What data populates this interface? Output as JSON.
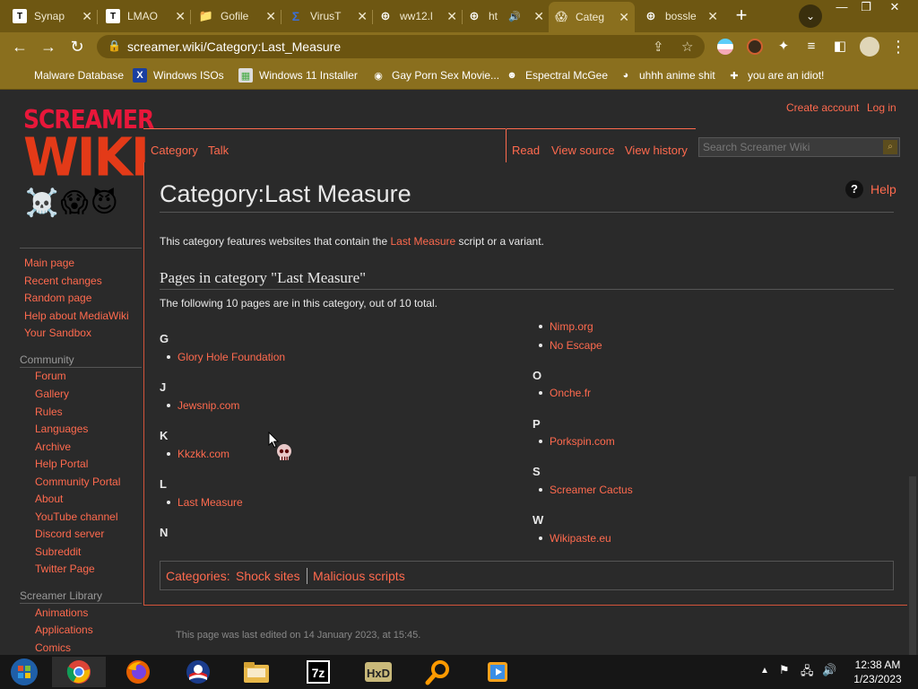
{
  "browser": {
    "tabs": [
      {
        "title": "Synap",
        "icon": "T"
      },
      {
        "title": "LMAO",
        "icon": "T"
      },
      {
        "title": "Gofile",
        "icon": "gofile-icon"
      },
      {
        "title": "VirusT",
        "icon": "virustotal-icon"
      },
      {
        "title": "ww12.l",
        "icon": "globe-icon"
      },
      {
        "title": "ht",
        "icon": "globe-icon"
      },
      {
        "title": "Categ",
        "icon": "screamer-icon"
      },
      {
        "title": "bossle",
        "icon": "globe-icon"
      }
    ],
    "active_tab_index": 6,
    "url_host": "screamer.wiki",
    "url_path": "/Category:Last_Measure",
    "bookmarks": [
      "Malware Database",
      "Windows ISOs",
      "Windows 11 Installer",
      "Gay Porn Sex Movie...",
      "Espectral McGee",
      "uhhh anime shit",
      "you are an idiot!"
    ]
  },
  "wiki": {
    "logo_line1": "SCREAMER",
    "logo_line2": "WIKI",
    "logo_emojis": "☠️😱😈",
    "account": {
      "create": "Create account",
      "login": "Log in"
    },
    "tabs_left": [
      "Category",
      "Talk"
    ],
    "tabs_right": [
      "Read",
      "View source",
      "View history"
    ],
    "search_placeholder": "Search Screamer Wiki",
    "sidebar_main": [
      "Main page",
      "Recent changes",
      "Random page",
      "Help about MediaWiki",
      "Your Sandbox"
    ],
    "sidebar_community_heading": "Community",
    "sidebar_community": [
      "Forum",
      "Gallery",
      "Rules",
      "Languages",
      "Archive",
      "Help Portal",
      "Community Portal",
      "About",
      "YouTube channel",
      "Discord server",
      "Subreddit",
      "Twitter Page"
    ],
    "sidebar_library_heading": "Screamer Library",
    "sidebar_library": [
      "Animations",
      "Applications",
      "Comics"
    ],
    "page_title": "Category:Last Measure",
    "help_label": "Help",
    "intro_before": "This category features websites that contain the ",
    "intro_link": "Last Measure",
    "intro_after": " script or a variant.",
    "subheading": "Pages in category \"Last Measure\"",
    "count_text": "The following 10 pages are in this category, out of 10 total.",
    "groups_left": [
      {
        "letter": "G",
        "pages": [
          "Glory Hole Foundation"
        ]
      },
      {
        "letter": "J",
        "pages": [
          "Jewsnip.com"
        ]
      },
      {
        "letter": "K",
        "pages": [
          "Kkzkk.com"
        ]
      },
      {
        "letter": "L",
        "pages": [
          "Last Measure"
        ]
      },
      {
        "letter": "N",
        "pages": []
      }
    ],
    "groups_right_continued": [
      "Nimp.org",
      "No Escape"
    ],
    "groups_right": [
      {
        "letter": "O",
        "pages": [
          "Onche.fr"
        ]
      },
      {
        "letter": "P",
        "pages": [
          "Porkspin.com"
        ]
      },
      {
        "letter": "S",
        "pages": [
          "Screamer Cactus"
        ]
      },
      {
        "letter": "W",
        "pages": [
          "Wikipaste.eu"
        ]
      }
    ],
    "categories_label": "Categories:",
    "categories": [
      "Shock sites",
      "Malicious scripts"
    ],
    "footer": "This page was last edited on 14 January 2023, at 15:45."
  },
  "taskbar": {
    "time": "12:38 AM",
    "date": "1/23/2023"
  }
}
